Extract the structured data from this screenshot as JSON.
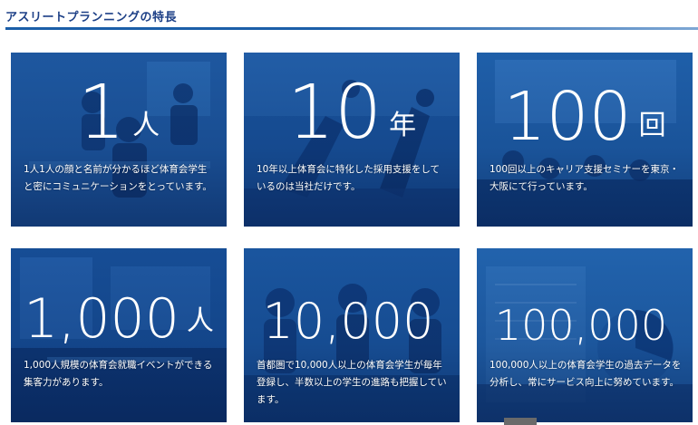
{
  "section": {
    "title": "アスリートプランニングの特長"
  },
  "features": [
    {
      "number": "1",
      "unit": "人",
      "description": "1人1人の顔と名前が分かるほど体育会学生と密にコミュニケーションをとっています。"
    },
    {
      "number": "10",
      "unit": "年",
      "description": "10年以上体育会に特化した採用支援をしているのは当社だけです。"
    },
    {
      "number": "100",
      "unit": "回",
      "description": "100回以上のキャリア支援セミナーを東京・大阪にて行っています。"
    },
    {
      "number": "1,000",
      "unit": "人",
      "description": "1,000人規模の体育会就職イベントができる集客力があります。"
    },
    {
      "number": "10,000",
      "unit": "",
      "description": "首都圏で10,000人以上の体育会学生が毎年登録し、半数以上の学生の進路も把握しています。"
    },
    {
      "number": "100,000",
      "unit": "",
      "description": "100,000人以上の体育会学生の過去データを分析し、常にサービス向上に努めています。"
    }
  ],
  "colors": {
    "title": "#1c3f86",
    "rule": "#1b5ea8",
    "card_overlay": "#174d93"
  }
}
